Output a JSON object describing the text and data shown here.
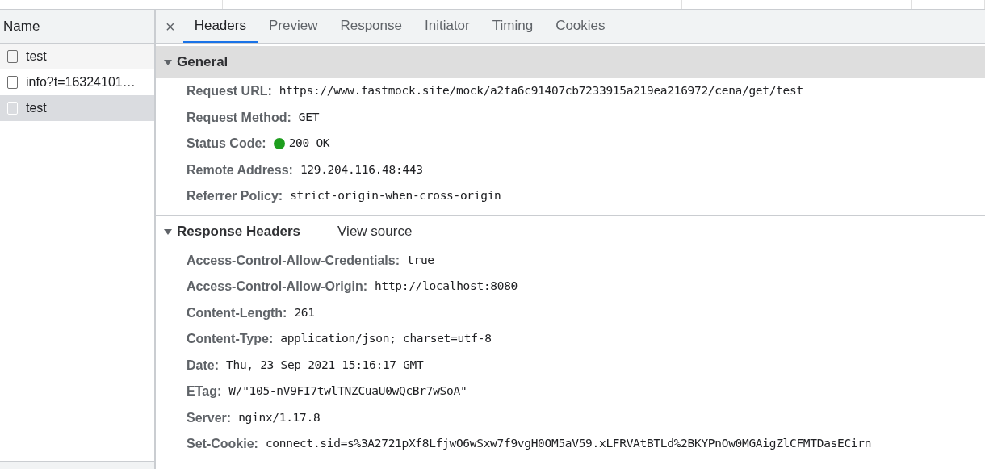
{
  "request_list": {
    "heading": "Name",
    "items": [
      {
        "name": "test",
        "selected": false
      },
      {
        "name": "info?t=16324101…",
        "selected": false
      },
      {
        "name": "test",
        "selected": true
      }
    ]
  },
  "detail": {
    "close": "×",
    "tabs": [
      {
        "label": "Headers",
        "selected": true
      },
      {
        "label": "Preview",
        "selected": false
      },
      {
        "label": "Response",
        "selected": false
      },
      {
        "label": "Initiator",
        "selected": false
      },
      {
        "label": "Timing",
        "selected": false
      },
      {
        "label": "Cookies",
        "selected": false
      }
    ],
    "sections": [
      {
        "title": "General",
        "expanded": true,
        "highlighted": true,
        "rows": [
          {
            "key": "Request URL:",
            "value": "https://www.fastmock.site/mock/a2fa6c91407cb7233915a219ea216972/cena/get/test"
          },
          {
            "key": "Request Method:",
            "value": "GET"
          },
          {
            "key": "Status Code:",
            "value": "200 OK",
            "color": "#1e9e1e"
          },
          {
            "key": "Remote Address:",
            "value": "129.204.116.48:443"
          },
          {
            "key": "Referrer Policy:",
            "value": "strict-origin-when-cross-origin"
          }
        ]
      },
      {
        "title": "Response Headers",
        "expanded": true,
        "highlighted": false,
        "link": "View source",
        "rows": [
          {
            "key": "Access-Control-Allow-Credentials:",
            "value": "true"
          },
          {
            "key": "Access-Control-Allow-Origin:",
            "value": "http://localhost:8080"
          },
          {
            "key": "Content-Length:",
            "value": "261"
          },
          {
            "key": "Content-Type:",
            "value": "application/json; charset=utf-8"
          },
          {
            "key": "Date:",
            "value": "Thu, 23 Sep 2021 15:16:17 GMT"
          },
          {
            "key": "ETag:",
            "value": "W/\"105-nV9FI7twlTNZCuaU0wQcBr7wSoA\""
          },
          {
            "key": "Server:",
            "value": "nginx/1.17.8"
          },
          {
            "key": "Set-Cookie:",
            "value": "connect.sid=s%3A2721pXf8LfjwO6wSxw7f9vgH0OM5aV59.xLFRVAtBTLd%2BKYPnOw0MGAigZlCFMTDasECirn"
          }
        ]
      }
    ]
  }
}
